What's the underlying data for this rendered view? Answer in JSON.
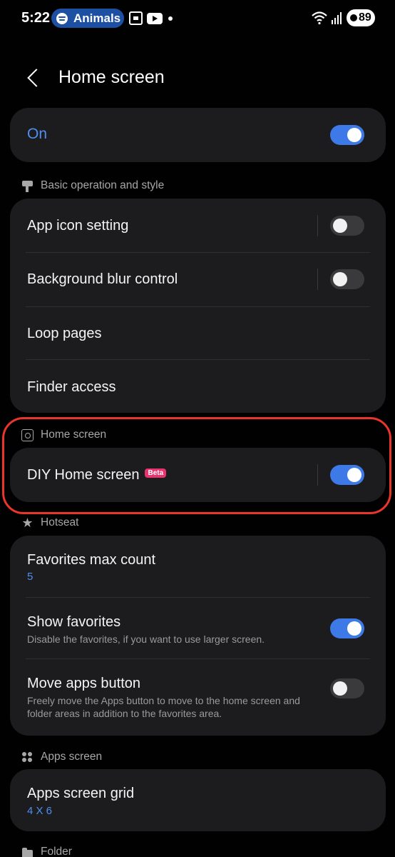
{
  "status_bar": {
    "time": "5:22",
    "media_pill": "Animals",
    "battery": "89",
    "icons": [
      "spotify-icon",
      "screenshot-icon",
      "youtube-icon",
      "wifi-icon",
      "signal-icon",
      "battery-icon"
    ]
  },
  "header": {
    "title": "Home screen",
    "back_icon": "back-arrow-icon"
  },
  "master": {
    "label": "On",
    "enabled": true
  },
  "sections": {
    "basic": {
      "title": "Basic operation and style",
      "items": [
        {
          "label": "App icon setting",
          "toggle": false
        },
        {
          "label": "Background blur control",
          "toggle": false
        },
        {
          "label": "Loop pages"
        },
        {
          "label": "Finder access"
        }
      ]
    },
    "home": {
      "title": "Home screen",
      "items": [
        {
          "label": "DIY Home screen",
          "badge": "Beta",
          "toggle": true
        }
      ]
    },
    "hotseat": {
      "title": "Hotseat",
      "items": [
        {
          "label": "Favorites max count",
          "value": "5"
        },
        {
          "label": "Show favorites",
          "sub": "Disable the favorites, if you want to use larger screen.",
          "toggle": true
        },
        {
          "label": "Move apps button",
          "sub": "Freely move the Apps button to move to the home screen and folder areas in addition to the favorites area.",
          "toggle": false
        }
      ]
    },
    "apps": {
      "title": "Apps screen",
      "items": [
        {
          "label": "Apps screen grid",
          "value": "4 X 6"
        }
      ]
    },
    "folder": {
      "title": "Folder"
    }
  },
  "colors": {
    "accent": "#3d7ae8",
    "value_text": "#4f8ff0",
    "highlight": "#e9352a",
    "beta_badge": "#e8336f"
  }
}
